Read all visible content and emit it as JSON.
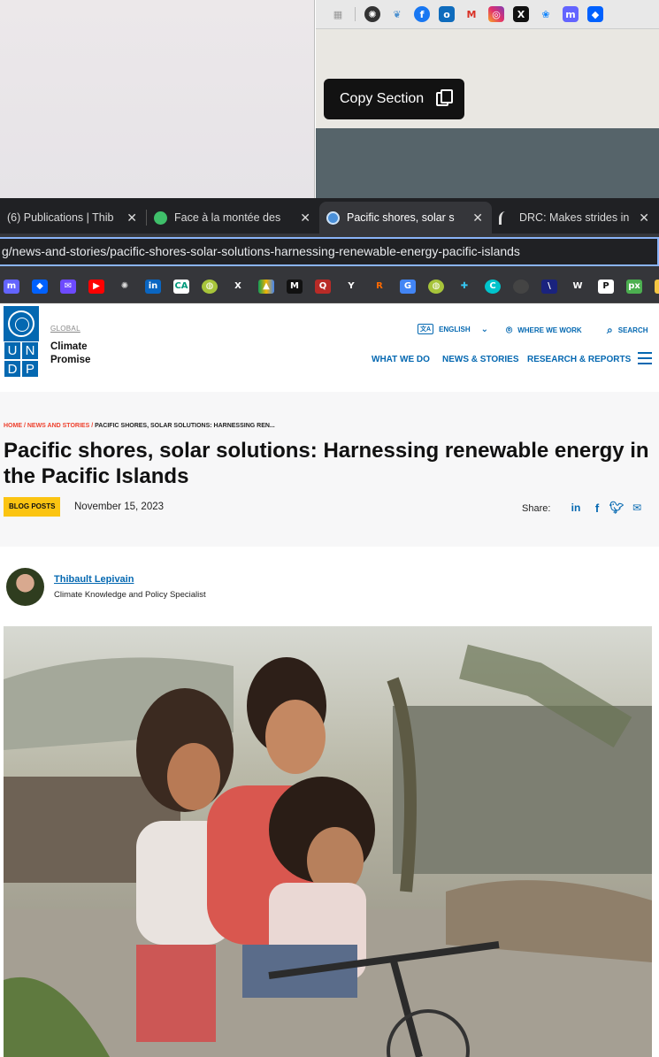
{
  "overlay": {
    "copy_section_label": "Copy Section"
  },
  "extensions": [
    "apps-icon",
    "chatgpt-icon",
    "leaf-icon",
    "facebook-icon",
    "outlook-icon",
    "gmail-icon",
    "instagram-icon",
    "x-icon",
    "bluesky-icon",
    "mastodon-icon",
    "dropbox-icon"
  ],
  "tabs": [
    {
      "title": "(6) Publications | Thib",
      "icon": "linkedin-icon",
      "active": false
    },
    {
      "title": "Face à la montée des",
      "icon": "green-leaf-icon",
      "active": false
    },
    {
      "title": "Pacific shores, solar s",
      "icon": "un-icon",
      "active": true
    },
    {
      "title": "DRC: Makes strides in",
      "icon": "arc-icon",
      "active": false
    }
  ],
  "address_bar": {
    "url": "g/news-and-stories/pacific-shores-solar-solutions-harnessing-renewable-energy-pacific-islands"
  },
  "bookmarks": [
    "mastodon",
    "dropbox",
    "proton-mail",
    "youtube",
    "openai",
    "linkedin",
    "credit-agricole",
    "globe",
    "x",
    "drive",
    "medium",
    "quora",
    "ycombinator",
    "rakuten",
    "translate",
    "globe-2",
    "slack",
    "canva",
    "circle",
    "vimeo",
    "wordpress",
    "pepper",
    "pixabay",
    "folder"
  ],
  "header": {
    "global_label": "GLOBAL",
    "brand_name": "Climate Promise",
    "logo_letters": [
      "U",
      "N",
      "D",
      "P"
    ],
    "language": "ENGLISH",
    "where_we_work": "WHERE WE WORK",
    "search": "SEARCH",
    "nav": [
      "WHAT WE DO",
      "NEWS & STORIES",
      "RESEARCH & REPORTS"
    ]
  },
  "breadcrumb": {
    "home": "HOME",
    "section": "NEWS AND STORIES",
    "current": "PACIFIC SHORES, SOLAR SOLUTIONS: HARNESSING REN..."
  },
  "article": {
    "title": "Pacific shores, solar solutions: Harnessing renewable energy in the Pacific Islands",
    "badge": "BLOG POSTS",
    "date": "November 15, 2023",
    "share_label": "Share:",
    "author_name": "Thibault Lepivain",
    "author_role": "Climate Knowledge and Policy Specialist"
  },
  "colors": {
    "undp_blue": "#0468b1",
    "badge_yellow": "#fbc412",
    "breadcrumb_red": "#ee402d"
  }
}
